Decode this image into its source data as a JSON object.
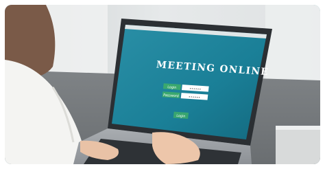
{
  "screen": {
    "title": "MEETING ONLINE",
    "login_label": "Login",
    "password_label": "Password",
    "login_mask": "••••••",
    "password_mask": "••••••",
    "login_button": "Login"
  },
  "colors": {
    "screen_bg": "#1a7f97",
    "label_green": "#3aa86e",
    "title": "#ffffff",
    "border_accent": "#0a7f86"
  }
}
